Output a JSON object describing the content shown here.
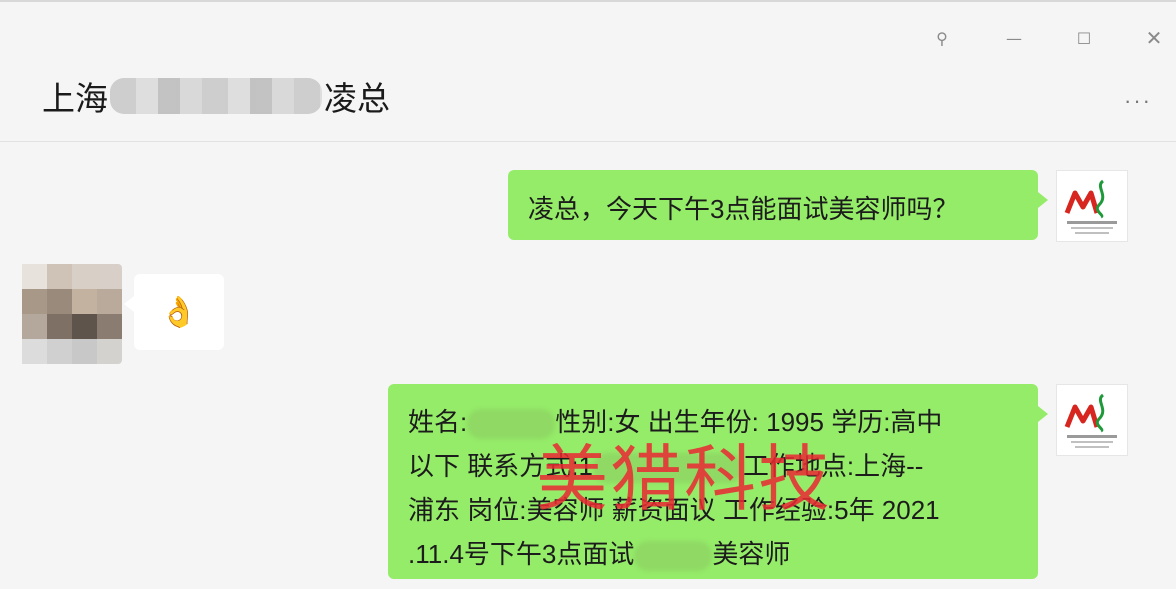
{
  "window": {
    "pin_glyph": "⚲",
    "minimize_glyph": "—",
    "maximize_glyph": "☐",
    "close_glyph": "✕",
    "more_glyph": "···"
  },
  "chat": {
    "title_prefix": "上海",
    "title_suffix": "凌总"
  },
  "messages": {
    "m1_text": "凌总，今天下午3点能面试美容师吗？",
    "m2_emoji": "👌",
    "m3": {
      "l1a": "姓名:",
      "l1b": "性别:女 出生年份: 1995 学历:高中",
      "l2a": "以下 联系方式:1",
      "l2b": "工作地点:上海--",
      "l3": "浦东 岗位:美容师 薪资面议 工作经验:5年 2021",
      "l4a": ".11.4号下午3点面试",
      "l4b": "美容师"
    }
  },
  "watermark": "美猎科技",
  "colors": {
    "bubble_self": "#95ec69",
    "bubble_other": "#ffffff",
    "watermark": "#eb2832",
    "logo_red": "#d6261f",
    "logo_green": "#1f9a3a"
  }
}
